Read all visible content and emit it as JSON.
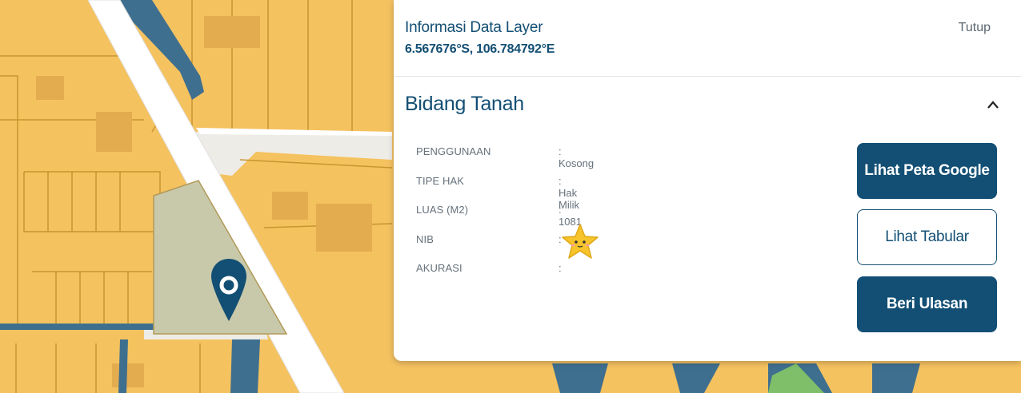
{
  "colors": {
    "parcel": "#f5c260",
    "parcel_border": "#c8952f",
    "road": "#ffffff",
    "river": "#3f6f8f",
    "selected": "#c8c9aa",
    "panel_accent": "#134f74"
  },
  "map": {
    "marker": "location-pin-icon",
    "sticker": "star-emoji-icon"
  },
  "info_panel": {
    "title": "Informasi Data Layer",
    "coordinates": "6.567676°S, 106.784792°E",
    "close_label": "Tutup",
    "section_title": "Bidang Tanah",
    "collapse_icon": "chevron-up-icon",
    "attributes": [
      {
        "key": "PENGGUNAAN",
        "value": ": Kosong"
      },
      {
        "key": "TIPE HAK",
        "value": ": Hak Milik"
      },
      {
        "key": "LUAS (M2)",
        "value": ": 1081"
      },
      {
        "key": "NIB",
        "value": ":"
      },
      {
        "key": "AKURASI",
        "value": ":"
      }
    ],
    "buttons": {
      "google_map": "Lihat Peta Google",
      "tabular": "Lihat Tabular",
      "review": "Beri Ulasan"
    }
  }
}
